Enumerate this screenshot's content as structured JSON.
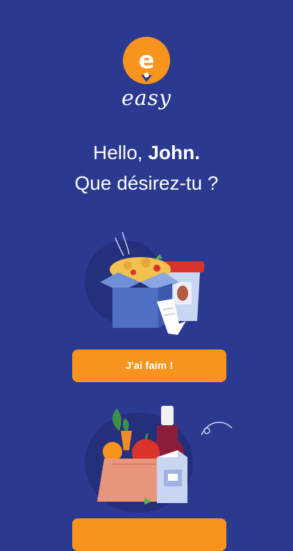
{
  "brand": {
    "name": "easy",
    "icon": "pin-e-logo-icon"
  },
  "greeting": {
    "hello": "Hello,",
    "name": "John.",
    "question": "Que désirez-tu ?"
  },
  "options": [
    {
      "label": "J'ai faim !",
      "icon": "takeaway-meal-illustration"
    },
    {
      "label": "",
      "icon": "groceries-illustration"
    }
  ],
  "colors": {
    "background": "#2b3990",
    "accent": "#f7941d",
    "text": "#ffffff"
  }
}
